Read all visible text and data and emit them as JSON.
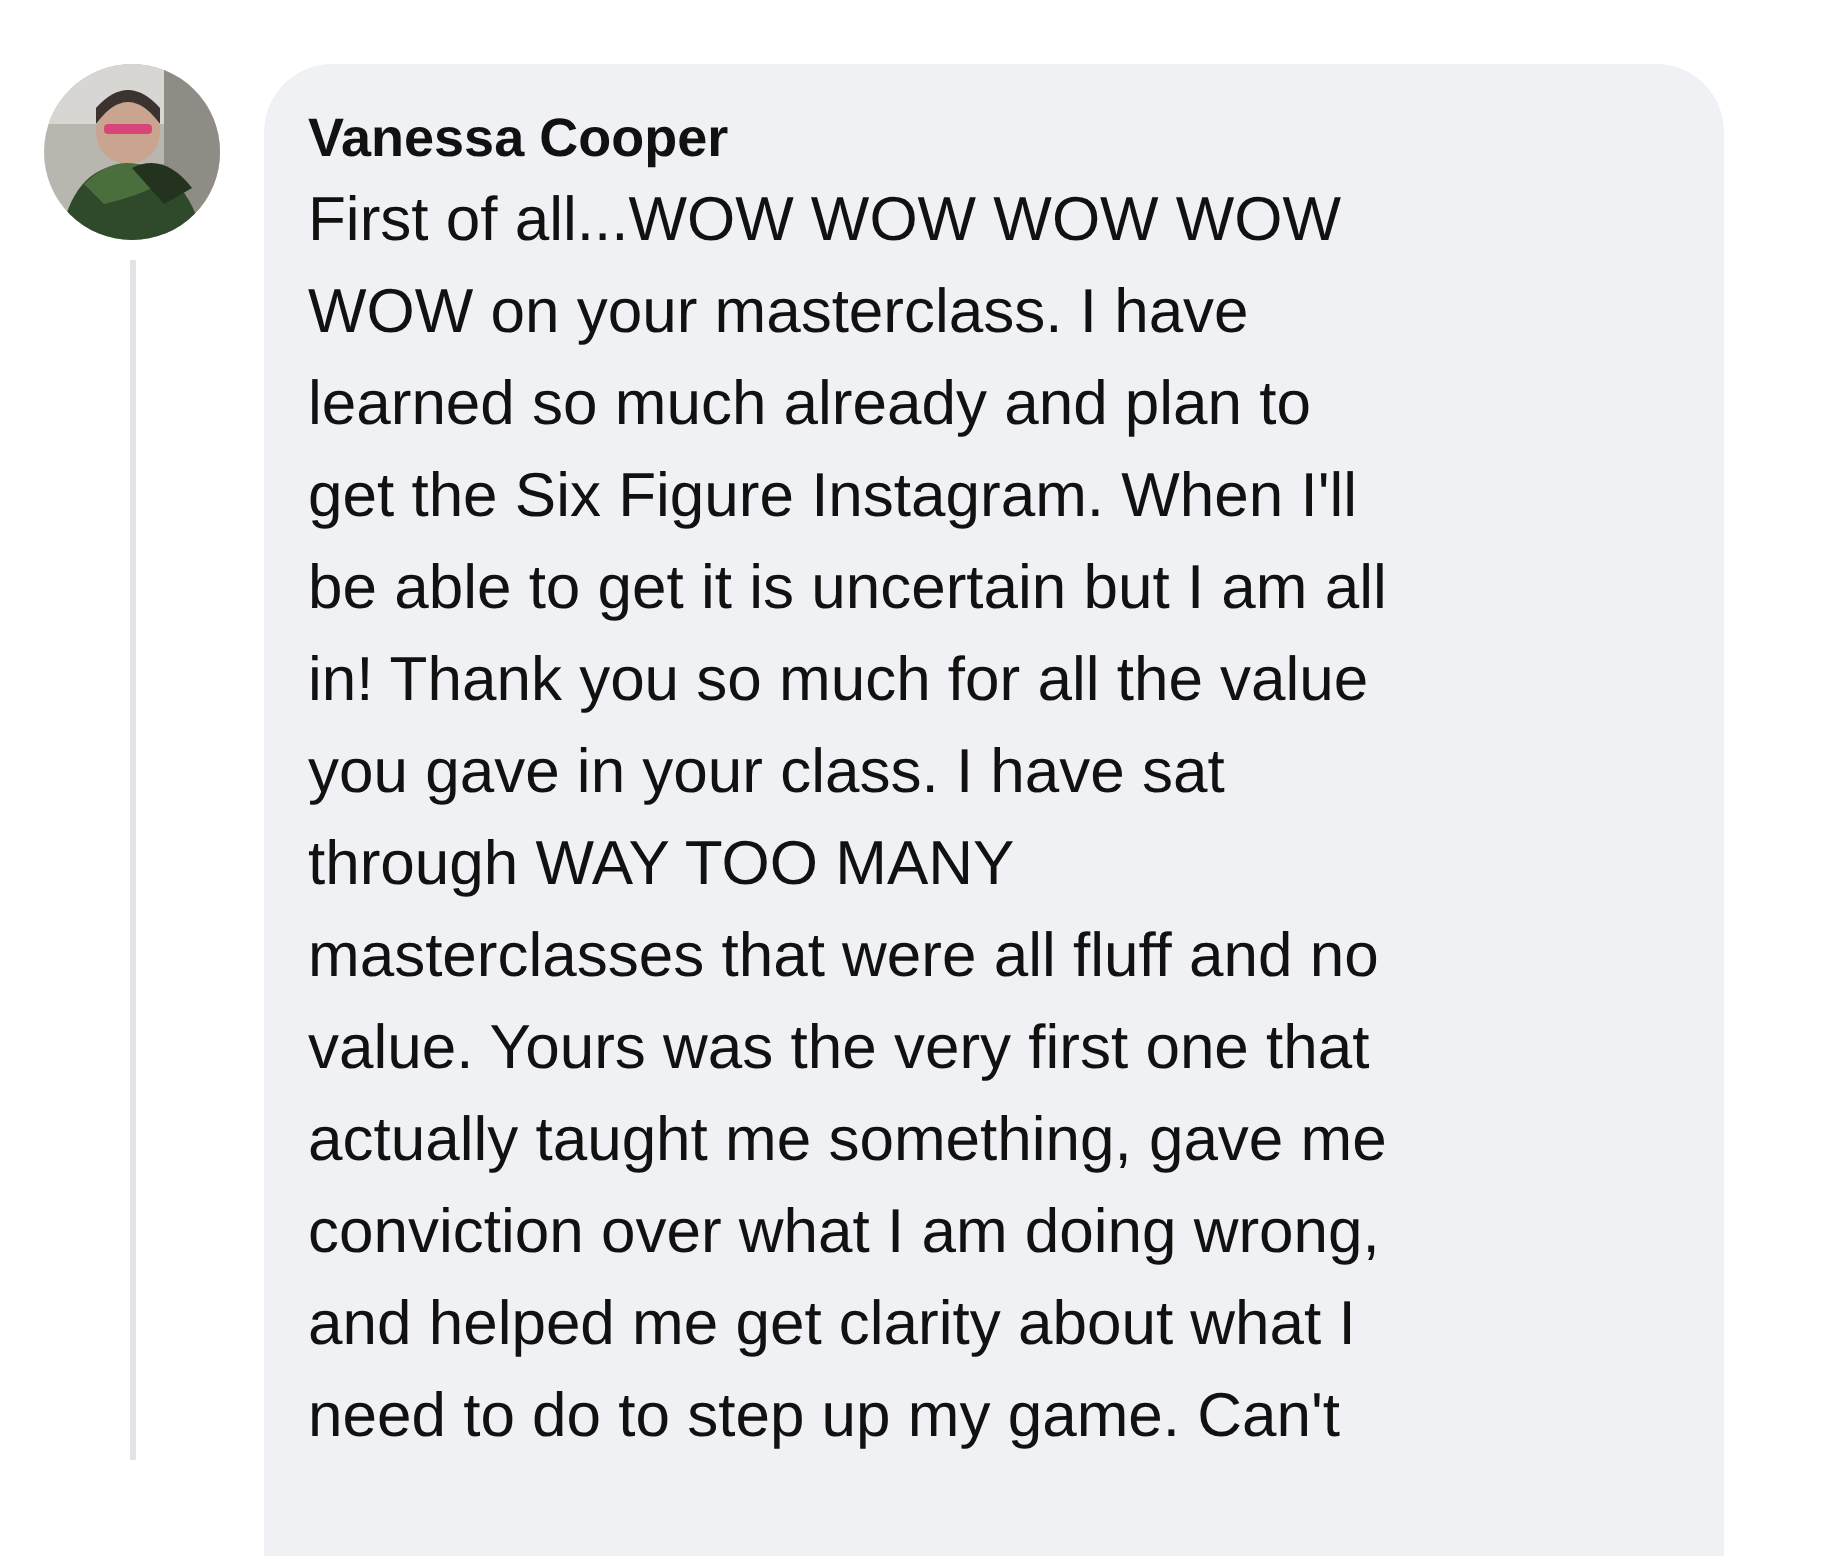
{
  "comment": {
    "author": "Vanessa Cooper",
    "text": "First of all...WOW WOW WOW WOW\nWOW on your masterclass. I have\nlearned so much already and plan to\nget the Six Figure Instagram. When I'll\nbe able to get it is uncertain but I am all\nin! Thank you so much for all the value\nyou gave in your class. I have sat\nthrough WAY TOO MANY\nmasterclasses that were all fluff and no\nvalue. Yours was the very first one that\nactually taught me something, gave me\nconviction over what I am doing wrong,\nand helped me get clarity about what I\nneed to do to step up my game. Can't"
  }
}
